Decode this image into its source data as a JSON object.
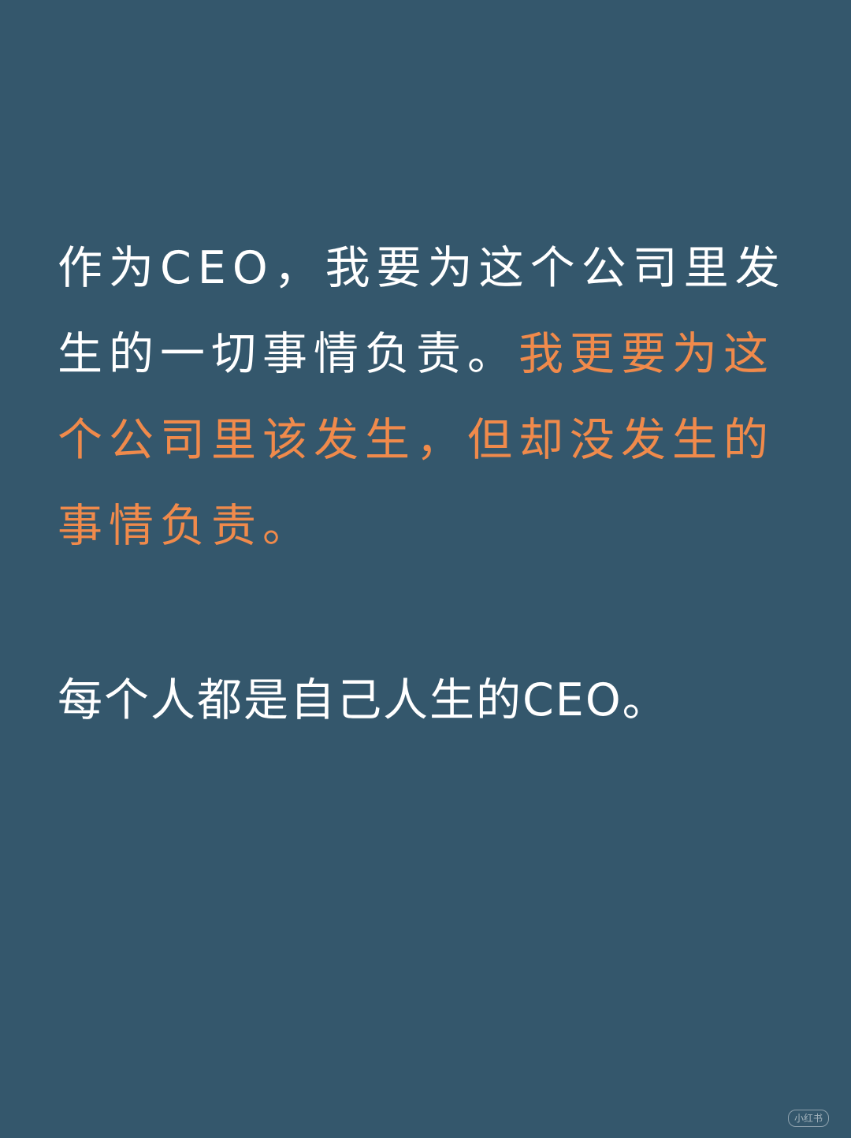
{
  "quote": {
    "normal_text": "作为CEO，我要为这个公司里发生的一切事情负责。",
    "highlight_text": "我更要为这个公司里该发生，但却没发生的事情负责。",
    "highlight_color": "#f08a4b"
  },
  "closing": {
    "text": "每个人都是自己人生的CEO。"
  },
  "watermark": {
    "text": "小红书"
  },
  "colors": {
    "background": "#34576c",
    "text": "#ffffff"
  }
}
